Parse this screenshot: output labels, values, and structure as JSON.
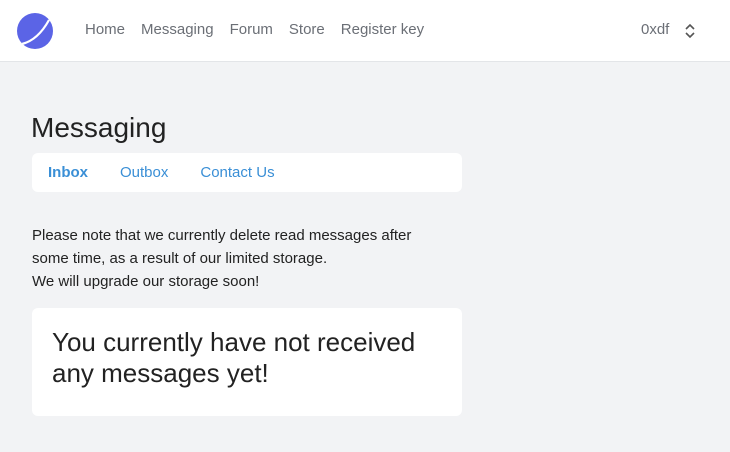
{
  "nav": {
    "items": [
      "Home",
      "Messaging",
      "Forum",
      "Store",
      "Register key"
    ]
  },
  "user": {
    "name": "0xdf"
  },
  "page": {
    "title": "Messaging",
    "tabs": [
      {
        "label": "Inbox",
        "active": true
      },
      {
        "label": "Outbox",
        "active": false
      },
      {
        "label": "Contact Us",
        "active": false
      }
    ],
    "notice_line1": "Please note that we currently delete read messages after some time, as a result of our limited storage.",
    "notice_line2": "We will upgrade our storage soon!",
    "empty_message": "You currently have not received any messages yet!"
  },
  "colors": {
    "accent": "#3a8fd6",
    "logo": "#5b64e6",
    "background": "#f2f3f5"
  }
}
